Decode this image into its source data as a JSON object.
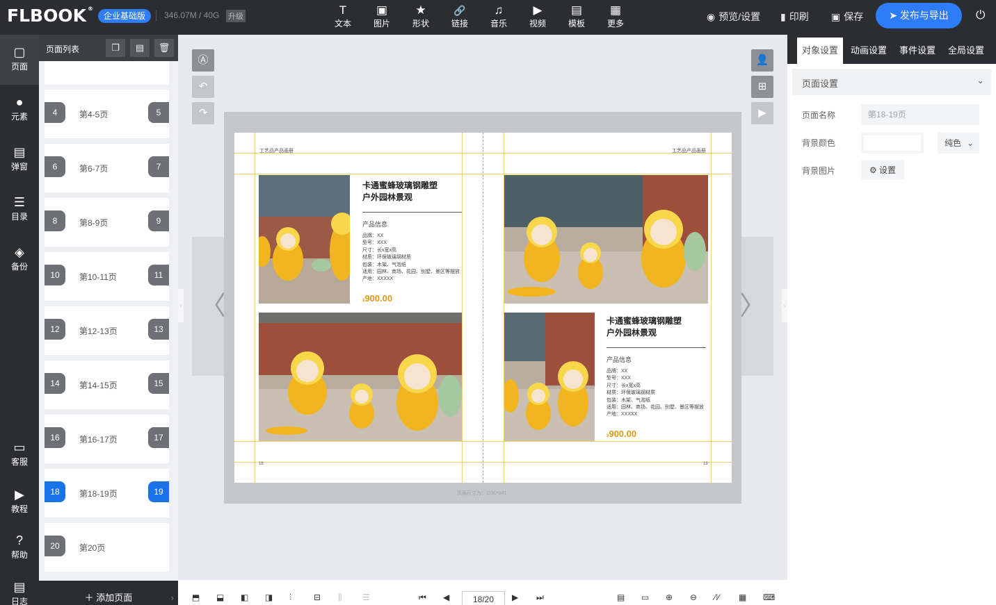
{
  "topbar": {
    "logo": "FLBOOK",
    "edition": "企业基础版",
    "storage": "346.07M / 40G",
    "upgrade": "升级",
    "tools": [
      {
        "icon": "T",
        "label": "文本"
      },
      {
        "icon": "▣",
        "label": "图片"
      },
      {
        "icon": "★",
        "label": "形状"
      },
      {
        "icon": "🔗",
        "label": "链接"
      },
      {
        "icon": "♫",
        "label": "音乐"
      },
      {
        "icon": "▶",
        "label": "视频"
      },
      {
        "icon": "▤",
        "label": "模板"
      },
      {
        "icon": "▦",
        "label": "更多"
      }
    ],
    "preview": "预览/设置",
    "print": "印刷",
    "save": "保存",
    "publish": "发布与导出"
  },
  "leftnav": [
    {
      "icon": "▢",
      "label": "页面"
    },
    {
      "icon": "●",
      "label": "元素"
    },
    {
      "icon": "▤",
      "label": "弹窗"
    },
    {
      "icon": "☰",
      "label": "目录"
    },
    {
      "icon": "◈",
      "label": "备份"
    },
    {
      "icon": "▭",
      "label": "客服"
    },
    {
      "icon": "▶",
      "label": "教程"
    },
    {
      "icon": "?",
      "label": "帮助"
    },
    {
      "icon": "▤",
      "label": "日志"
    }
  ],
  "pagepanel": {
    "title": "页面列表",
    "items": [
      {
        "left": "4",
        "label": "第4-5页",
        "right": "5"
      },
      {
        "left": "6",
        "label": "第6-7页",
        "right": "7"
      },
      {
        "left": "8",
        "label": "第8-9页",
        "right": "9"
      },
      {
        "left": "10",
        "label": "第10-11页",
        "right": "11"
      },
      {
        "left": "12",
        "label": "第12-13页",
        "right": "13"
      },
      {
        "left": "14",
        "label": "第14-15页",
        "right": "15"
      },
      {
        "left": "16",
        "label": "第16-17页",
        "right": "17"
      },
      {
        "left": "18",
        "label": "第18-19页",
        "right": "19"
      },
      {
        "left": "20",
        "label": "第20页",
        "right": ""
      }
    ],
    "add_page": "添加页面"
  },
  "canvas": {
    "header_left": "工艺品产品画册",
    "header_right": "工艺品产品画册",
    "page_left": "18",
    "page_right": "19",
    "page_size": "页面尺寸为：1190*841",
    "product": {
      "title_line1": "卡通蜜蜂玻璃钢雕塑",
      "title_line2": "户外园林景观",
      "info_title": "产品信息",
      "specs": [
        "品牌：XX",
        "型号：XXX",
        "尺寸：长x宽x高",
        "材质：环保玻璃钢材质",
        "包装：木架、气泡纸",
        "适用：园林、商场、花园、别墅、景区等摆放",
        "产地：XXXXX"
      ],
      "price_prefix": "¥",
      "price": "900.00"
    }
  },
  "rightpanel": {
    "tabs": [
      "对象设置",
      "动画设置",
      "事件设置",
      "全局设置"
    ],
    "section": "页面设置",
    "page_name_label": "页面名称",
    "page_name_placeholder": "第18-19页",
    "bg_color_label": "背景颜色",
    "bg_color_mode": "纯色",
    "bg_image_label": "背景图片",
    "bg_image_button": "设置"
  },
  "bottombar": {
    "current_page": "18/20"
  },
  "colors": {
    "accent": "#2f7df6",
    "dark": "#2b2d31",
    "price": "#e09a18",
    "guide": "#f3cf7a"
  }
}
